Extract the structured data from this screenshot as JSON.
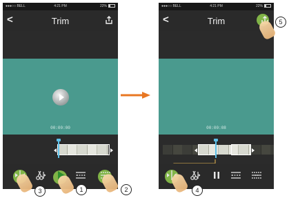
{
  "left_screen": {
    "status": {
      "carrier": "●●●○○ BELL",
      "time": "4:21 PM",
      "battery": "22%"
    },
    "nav": {
      "back_glyph": "<",
      "title": "Trim",
      "share_icon": "share-icon"
    },
    "video": {
      "timecode": "00:00:00"
    },
    "toolbar": {
      "icons": [
        "split-icon",
        "scissors-icon",
        "play-icon",
        "spread-icon",
        "merge-icon"
      ]
    }
  },
  "right_screen": {
    "status": {
      "carrier": "●●●○○ BELL",
      "time": "4:21 PM",
      "battery": "22%"
    },
    "nav": {
      "back_glyph": "<",
      "title": "Trim",
      "share_icon": "share-icon"
    },
    "video": {
      "timecode": "00:00:08"
    },
    "toolbar": {
      "icons": [
        "split-icon",
        "scissors-icon",
        "pause-icon",
        "spread-icon",
        "merge-icon"
      ]
    }
  },
  "callouts": [
    "1",
    "2",
    "3",
    "4",
    "5"
  ],
  "colors": {
    "video_bg": "#4a9a8e",
    "highlight": "#8bc34a",
    "arrow": "#e87722",
    "cursor": "#5ec0e8"
  }
}
